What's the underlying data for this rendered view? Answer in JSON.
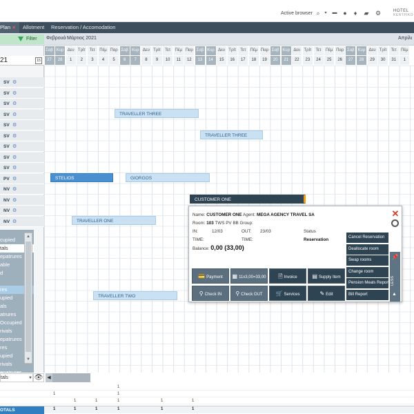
{
  "topbar": {
    "active_browser": "Active browser",
    "hotel_line1": "HOTEL",
    "hotel_line2": "ΚΕΝΤΡΙΚΟ"
  },
  "tabs": [
    {
      "label": "Plan",
      "close": "×"
    },
    {
      "label": "Allotment"
    },
    {
      "label": "Reservation / Accomodation"
    }
  ],
  "filter_label": "Filter",
  "months": [
    "Φεβρουά",
    "Μάρτιος 2021",
    "Απρίλι"
  ],
  "date_input": "21",
  "calendar_icon_text": "15",
  "day_names": [
    "Σαβ",
    "Κυρ",
    "Δευ",
    "Τρίτ",
    "Τετ",
    "Πέμ",
    "Παρ",
    "Σαβ",
    "Κυρ",
    "Δευ",
    "Τρίτ",
    "Τετ",
    "Πέμ",
    "Παρ",
    "Σαβ",
    "Κυρ",
    "Δευ",
    "Τρίτ",
    "Τετ",
    "Πέμ",
    "Παρ",
    "Σαβ",
    "Κυρ",
    "Δευ",
    "Τρίτ",
    "Τετ",
    "Πέμ",
    "Παρ",
    "Σαβ",
    "Κυρ",
    "Δευ",
    "Τρίτ",
    "Τετ",
    "Πέμ"
  ],
  "day_numbers": [
    "27",
    "28",
    "1",
    "2",
    "3",
    "4",
    "5",
    "6",
    "7",
    "8",
    "9",
    "10",
    "11",
    "12",
    "13",
    "14",
    "15",
    "16",
    "17",
    "18",
    "19",
    "20",
    "21",
    "22",
    "23",
    "24",
    "25",
    "26",
    "27",
    "28",
    "29",
    "30",
    "31",
    "1"
  ],
  "weekend_indexes": [
    0,
    1,
    7,
    8,
    14,
    15,
    21,
    22,
    28,
    29
  ],
  "room_labels": [
    "SV",
    "SV",
    "SV",
    "SV",
    "SV",
    "SV",
    "SV",
    "SV",
    "SV",
    "PV",
    "NV",
    "NV",
    "NV",
    "NV"
  ],
  "bookings": [
    {
      "label": "TRAVELLER THREE",
      "style": "light"
    },
    {
      "label": "TRAVELLER THREE",
      "style": "light"
    },
    {
      "label": "STELIOS",
      "style": "dark"
    },
    {
      "label": "GIORGOS",
      "style": "light"
    },
    {
      "label": "CUSTOMER ONE",
      "style": "selected"
    },
    {
      "label": "TRAVELLER ONE",
      "style": "light"
    },
    {
      "label": "TRAVELLER TWO",
      "style": "light"
    }
  ],
  "dropdown_items": [
    "cupied",
    "tals",
    "epatrures",
    "able",
    "d",
    "",
    "res",
    "upied",
    "als",
    "atrures",
    "Occupied",
    "rivals",
    "epatrures",
    "res",
    "upied",
    "rivals",
    "epatrures"
  ],
  "bottom_select": "tals",
  "footer_values": [
    "1",
    "1",
    "1",
    "1",
    "1",
    "1",
    "1",
    "1"
  ],
  "totals_label": "OTALS",
  "totals_values": [
    "1",
    "1",
    "1",
    "1",
    "1",
    "1"
  ],
  "popup": {
    "name_label": "Name:",
    "name_value": "CUSTOMER ONE",
    "agent_label": "Agent:",
    "agent_value": "MEGA AGENCY TRAVEL SA",
    "room_label": "Room:",
    "room_value": "103",
    "room_extra": "TWS PV BB Group:",
    "in_label": "IN:",
    "in_value": "12/03",
    "out_label": "OUT:",
    "out_value": "23/03",
    "status_label": "Status",
    "time_label": "TIME:",
    "time2_label": "TIME:",
    "status_value": "Reservation",
    "balance_label": "Balance:",
    "balance_value": "0,00 (33,00)",
    "menu": [
      "Cancel Reservation",
      "Deallocate room",
      "Swap rooms",
      "Change room",
      "Pension Meals Report",
      "Bill Report"
    ],
    "less_label": "LESS",
    "actions_row1": [
      {
        "label": "Payment",
        "icon": "💳"
      },
      {
        "label": "11x3,00=33,00",
        "icon": "▦"
      },
      {
        "label": "Invoice",
        "icon": "🗎"
      },
      {
        "label": "Supply Item",
        "icon": "▤"
      }
    ],
    "actions_row2": [
      {
        "label": "Check IN",
        "icon": "⚲"
      },
      {
        "label": "Check OUT",
        "icon": "⚲"
      },
      {
        "label": "Services",
        "icon": "🛒"
      },
      {
        "label": "Edit",
        "icon": "✎"
      }
    ]
  }
}
